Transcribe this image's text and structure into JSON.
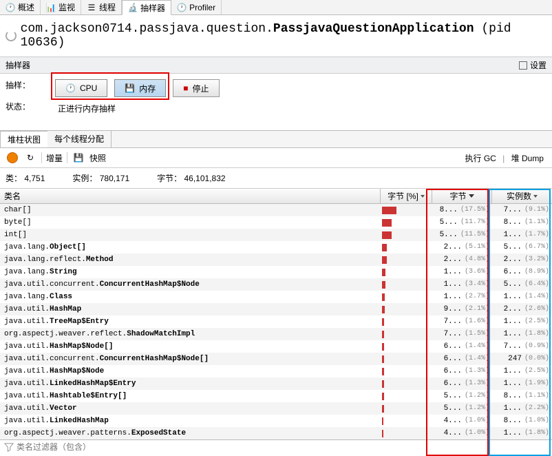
{
  "tabs": [
    "概述",
    "监视",
    "线程",
    "抽样器",
    "Profiler"
  ],
  "active_tab": 3,
  "title_prefix": "com.jackson0714.passjava.question.",
  "title_bold": "PassjavaQuestionApplication",
  "title_pid": " (pid 10636)",
  "sampler_label": "抽样器",
  "settings_label": "设置",
  "sample_label": "抽样：",
  "status_label": "状态：",
  "btn_cpu": "CPU",
  "btn_mem": "内存",
  "btn_stop": "停止",
  "status_text": "正进行内存抽样",
  "sub_tabs": [
    "堆柱状图",
    "每个线程分配"
  ],
  "active_sub_tab": 0,
  "toolbar_delta": "增量",
  "toolbar_snapshot": "快照",
  "action_gc": "执行 GC",
  "action_heapdump": "堆 Dump",
  "summary_classes_label": "类：",
  "summary_classes_val": "4,751",
  "summary_instances_label": "实例：",
  "summary_instances_val": "780,171",
  "summary_bytes_label": "字节：",
  "summary_bytes_val": "46,101,832",
  "col_name": "类名",
  "col_bytes_pct": "字节 [%]",
  "col_bytes": "字节",
  "col_instances": "实例数",
  "chart_data": {
    "type": "table",
    "columns": [
      "类名",
      "字节 [%] (bar width px)",
      "字节 值",
      "字节 %",
      "实例数 值",
      "实例数 %"
    ],
    "rows": [
      {
        "name_plain": "char[]",
        "bar": 21,
        "b": "8...",
        "bp": "(17.5%)",
        "i": "7...",
        "ip": "(9.1%)"
      },
      {
        "name_plain": "byte[]",
        "bar": 14,
        "b": "5...",
        "bp": "(11.7%)",
        "i": "8...",
        "ip": "(1.1%)"
      },
      {
        "name_plain": "int[]",
        "bar": 14,
        "b": "5...",
        "bp": "(11.5%)",
        "i": "1...",
        "ip": "(1.7%)"
      },
      {
        "name_pre": "java.lang.",
        "name_b": "Object[]",
        "bar": 7,
        "b": "2...",
        "bp": "(5.1%)",
        "i": "5...",
        "ip": "(6.7%)"
      },
      {
        "name_pre": "java.lang.reflect.",
        "name_b": "Method",
        "bar": 7,
        "b": "2...",
        "bp": "(4.8%)",
        "i": "2...",
        "ip": "(3.2%)"
      },
      {
        "name_pre": "java.lang.",
        "name_b": "String",
        "bar": 5,
        "b": "1...",
        "bp": "(3.6%)",
        "i": "6...",
        "ip": "(8.9%)"
      },
      {
        "name_pre": "java.util.concurrent.",
        "name_b": "ConcurrentHashMap$Node",
        "bar": 5,
        "b": "1...",
        "bp": "(3.4%)",
        "i": "5...",
        "ip": "(6.4%)"
      },
      {
        "name_pre": "java.lang.",
        "name_b": "Class",
        "bar": 4,
        "b": "1...",
        "bp": "(2.7%)",
        "i": "1...",
        "ip": "(1.4%)"
      },
      {
        "name_pre": "java.util.",
        "name_b": "HashMap",
        "bar": 4,
        "b": "9...",
        "bp": "(2.1%)",
        "i": "2...",
        "ip": "(2.6%)"
      },
      {
        "name_pre": "java.util.",
        "name_b": "TreeMap$Entry",
        "bar": 3,
        "b": "7...",
        "bp": "(1.6%)",
        "i": "1...",
        "ip": "(2.5%)"
      },
      {
        "name_pre": "org.aspectj.weaver.reflect.",
        "name_b": "ShadowMatchImpl",
        "bar": 3,
        "b": "7...",
        "bp": "(1.5%)",
        "i": "1...",
        "ip": "(1.8%)"
      },
      {
        "name_pre": "java.util.",
        "name_b": "HashMap$Node[]",
        "bar": 3,
        "b": "6...",
        "bp": "(1.4%)",
        "i": "7...",
        "ip": "(0.9%)"
      },
      {
        "name_pre": "java.util.concurrent.",
        "name_b": "ConcurrentHashMap$Node[]",
        "bar": 3,
        "b": "6...",
        "bp": "(1.4%)",
        "i": "247",
        "ip": "(0.0%)"
      },
      {
        "name_pre": "java.util.",
        "name_b": "HashMap$Node",
        "bar": 3,
        "b": "6...",
        "bp": "(1.3%)",
        "i": "1...",
        "ip": "(2.5%)"
      },
      {
        "name_pre": "java.util.",
        "name_b": "LinkedHashMap$Entry",
        "bar": 3,
        "b": "6...",
        "bp": "(1.3%)",
        "i": "1...",
        "ip": "(1.9%)"
      },
      {
        "name_pre": "java.util.",
        "name_b": "Hashtable$Entry[]",
        "bar": 3,
        "b": "5...",
        "bp": "(1.2%)",
        "i": "8...",
        "ip": "(1.1%)"
      },
      {
        "name_pre": "java.util.",
        "name_b": "Vector",
        "bar": 3,
        "b": "5...",
        "bp": "(1.2%)",
        "i": "1...",
        "ip": "(2.2%)"
      },
      {
        "name_pre": "java.util.",
        "name_b": "LinkedHashMap",
        "bar": 2,
        "b": "4...",
        "bp": "(1.0%)",
        "i": "8...",
        "ip": "(1.0%)"
      },
      {
        "name_pre": "org.aspectj.weaver.patterns.",
        "name_b": "ExposedState",
        "bar": 2,
        "b": "4...",
        "bp": "(1.0%)",
        "i": "1...",
        "ip": "(1.8%)"
      }
    ]
  },
  "filter_placeholder": "类名过滤器（包含）"
}
